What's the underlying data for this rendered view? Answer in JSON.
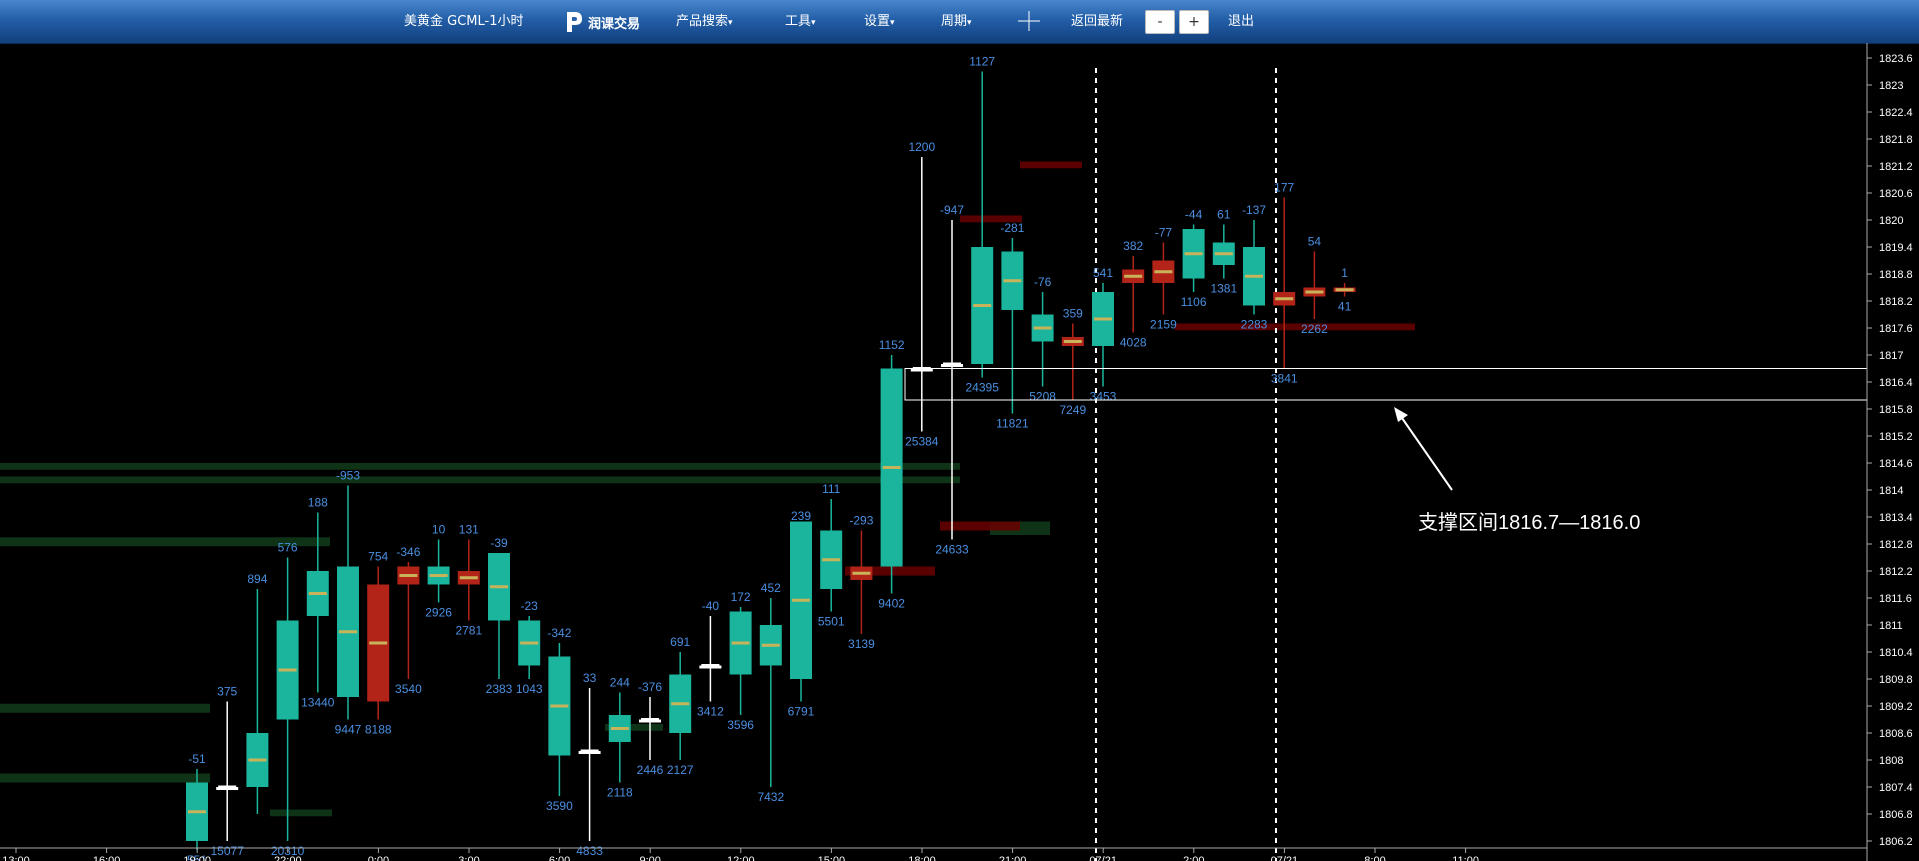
{
  "toolbar": {
    "title": "美黄金 GCML-1小时",
    "logo_text": "润课交易",
    "menu_products": "产品搜索",
    "menu_tools": "工具",
    "menu_settings": "设置",
    "menu_period": "周期",
    "back_latest": "返回最新",
    "zoom_out": "-",
    "zoom_in": "+",
    "exit": "退出",
    "crosshair_icon": "crosshair-icon",
    "caret_icon": "▾"
  },
  "annotation": {
    "text": "支撑区间1816.7—1816.0"
  },
  "chart_data": {
    "type": "candlestick",
    "instrument": "美黄金 GCML-1小时",
    "price_axis": [
      "1823.6",
      "1823",
      "1822.4",
      "1821.8",
      "1821.2",
      "1820.6",
      "1820",
      "1819.4",
      "1818.8",
      "1818.2",
      "1817.6",
      "1817",
      "1816.4",
      "1815.8",
      "1815.2",
      "1814.6",
      "1814",
      "1813.4",
      "1812.8",
      "1812.2",
      "1811.6",
      "1811",
      "1810.4",
      "1809.8",
      "1809.2",
      "1808.6",
      "1808",
      "1807.4",
      "1806.8",
      "1806.2"
    ],
    "time_axis": [
      "13:00",
      "16:00",
      "19:00",
      "22:00",
      "0:00",
      "3:00",
      "6:00",
      "9:00",
      "12:00",
      "15:00",
      "18:00",
      "21:00",
      "07/21",
      "2:00",
      "07/21",
      "8:00",
      "11:00"
    ],
    "ylim": [
      1806.2,
      1823.6
    ],
    "colors": {
      "up": "#1ab59c",
      "down": "#b32418",
      "doji": "#ffffff",
      "label": "#4a8fe0",
      "zone_green": "#113c1a",
      "zone_red": "#6b0000",
      "grid_axis": "#aaaaaa"
    },
    "candles": [
      {
        "o": 1806.2,
        "h": 1807.8,
        "l": 1806.0,
        "c": 1807.5,
        "top": "-51",
        "bot": "551"
      },
      {
        "o": 1807.4,
        "h": 1809.3,
        "l": 1806.2,
        "c": 1807.4,
        "top": "375",
        "bot": "15077"
      },
      {
        "o": 1807.4,
        "h": 1811.8,
        "l": 1806.8,
        "c": 1808.6,
        "top": "894",
        "bot": ""
      },
      {
        "o": 1808.9,
        "h": 1812.5,
        "l": 1806.2,
        "c": 1811.1,
        "top": "576",
        "bot": "20310"
      },
      {
        "o": 1811.2,
        "h": 1813.5,
        "l": 1809.5,
        "c": 1812.2,
        "top": "188",
        "bot": "13440"
      },
      {
        "o": 1809.4,
        "h": 1814.1,
        "l": 1808.9,
        "c": 1812.3,
        "top": "-953",
        "bot": "9447"
      },
      {
        "o": 1811.9,
        "h": 1812.3,
        "l": 1808.9,
        "c": 1809.3,
        "top": "754",
        "bot": "8188"
      },
      {
        "o": 1812.3,
        "h": 1812.4,
        "l": 1809.8,
        "c": 1811.9,
        "top": "-346",
        "bot": "3540"
      },
      {
        "o": 1811.9,
        "h": 1812.9,
        "l": 1811.5,
        "c": 1812.3,
        "top": "10",
        "bot": "2926"
      },
      {
        "o": 1812.2,
        "h": 1812.9,
        "l": 1811.1,
        "c": 1811.9,
        "top": "131",
        "bot": "2781"
      },
      {
        "o": 1811.1,
        "h": 1812.6,
        "l": 1809.8,
        "c": 1812.6,
        "top": "-39",
        "bot": "2383"
      },
      {
        "o": 1810.1,
        "h": 1811.2,
        "l": 1809.8,
        "c": 1811.1,
        "top": "-23",
        "bot": "1043"
      },
      {
        "o": 1808.1,
        "h": 1810.6,
        "l": 1807.2,
        "c": 1810.3,
        "top": "-342",
        "bot": "3590"
      },
      {
        "o": 1808.2,
        "h": 1809.6,
        "l": 1806.2,
        "c": 1808.2,
        "top": "33",
        "bot": "4833"
      },
      {
        "o": 1808.4,
        "h": 1809.5,
        "l": 1807.5,
        "c": 1809.0,
        "top": "244",
        "bot": "2118"
      },
      {
        "o": 1808.9,
        "h": 1809.4,
        "l": 1808.0,
        "c": 1808.9,
        "top": "-376",
        "bot": "2446"
      },
      {
        "o": 1808.6,
        "h": 1810.4,
        "l": 1808.0,
        "c": 1809.9,
        "top": "691",
        "bot": "2127"
      },
      {
        "o": 1810.1,
        "h": 1811.2,
        "l": 1809.3,
        "c": 1810.1,
        "top": "-40",
        "bot": "3412"
      },
      {
        "o": 1809.9,
        "h": 1811.4,
        "l": 1809.0,
        "c": 1811.3,
        "top": "172",
        "bot": "3596"
      },
      {
        "o": 1810.1,
        "h": 1811.6,
        "l": 1807.4,
        "c": 1811.0,
        "top": "452",
        "bot": "7432"
      },
      {
        "o": 1809.8,
        "h": 1813.2,
        "l": 1809.3,
        "c": 1813.3,
        "top": "239",
        "bot": "6791"
      },
      {
        "o": 1811.8,
        "h": 1813.8,
        "l": 1811.3,
        "c": 1813.1,
        "top": "111",
        "bot": "5501"
      },
      {
        "o": 1812.3,
        "h": 1813.1,
        "l": 1810.8,
        "c": 1812.0,
        "top": "-293",
        "bot": "3139"
      },
      {
        "o": 1812.3,
        "h": 1817.0,
        "l": 1811.7,
        "c": 1816.7,
        "top": "1152",
        "bot": "9402"
      },
      {
        "o": 1816.7,
        "h": 1821.4,
        "l": 1815.3,
        "c": 1816.7,
        "top": "1200",
        "bot": "25384"
      },
      {
        "o": 1816.8,
        "h": 1820.0,
        "l": 1812.9,
        "c": 1816.8,
        "top": "-947",
        "bot": "24633"
      },
      {
        "o": 1816.8,
        "h": 1823.3,
        "l": 1816.5,
        "c": 1819.4,
        "top": "1127",
        "bot": "24395"
      },
      {
        "o": 1818.0,
        "h": 1819.6,
        "l": 1815.7,
        "c": 1819.3,
        "top": "-281",
        "bot": "11821"
      },
      {
        "o": 1817.3,
        "h": 1818.4,
        "l": 1816.3,
        "c": 1817.9,
        "top": "-76",
        "bot": "5208"
      },
      {
        "o": 1817.4,
        "h": 1817.7,
        "l": 1816.0,
        "c": 1817.2,
        "top": "359",
        "bot": "7249"
      },
      {
        "o": 1817.2,
        "h": 1818.6,
        "l": 1816.3,
        "c": 1818.4,
        "top": "541",
        "bot": "3453"
      },
      {
        "o": 1818.9,
        "h": 1819.2,
        "l": 1817.5,
        "c": 1818.6,
        "top": "382",
        "bot": "4028"
      },
      {
        "o": 1819.1,
        "h": 1819.5,
        "l": 1817.9,
        "c": 1818.6,
        "top": "-77",
        "bot": "2159"
      },
      {
        "o": 1818.7,
        "h": 1819.9,
        "l": 1818.4,
        "c": 1819.8,
        "top": "-44",
        "bot": "1106"
      },
      {
        "o": 1819.0,
        "h": 1819.9,
        "l": 1818.7,
        "c": 1819.5,
        "top": "61",
        "bot": "1381"
      },
      {
        "o": 1818.1,
        "h": 1820.0,
        "l": 1817.9,
        "c": 1819.4,
        "top": "-137",
        "bot": "2283"
      },
      {
        "o": 1818.4,
        "h": 1820.5,
        "l": 1816.7,
        "c": 1818.1,
        "top": "177",
        "bot": "3841"
      },
      {
        "o": 1818.5,
        "h": 1819.3,
        "l": 1817.8,
        "c": 1818.3,
        "top": "54",
        "bot": "2262"
      },
      {
        "o": 1818.5,
        "h": 1818.6,
        "l": 1818.3,
        "c": 1818.4,
        "top": "1",
        "bot": "41"
      }
    ],
    "support_zone": [
      1816.0,
      1816.7
    ]
  }
}
